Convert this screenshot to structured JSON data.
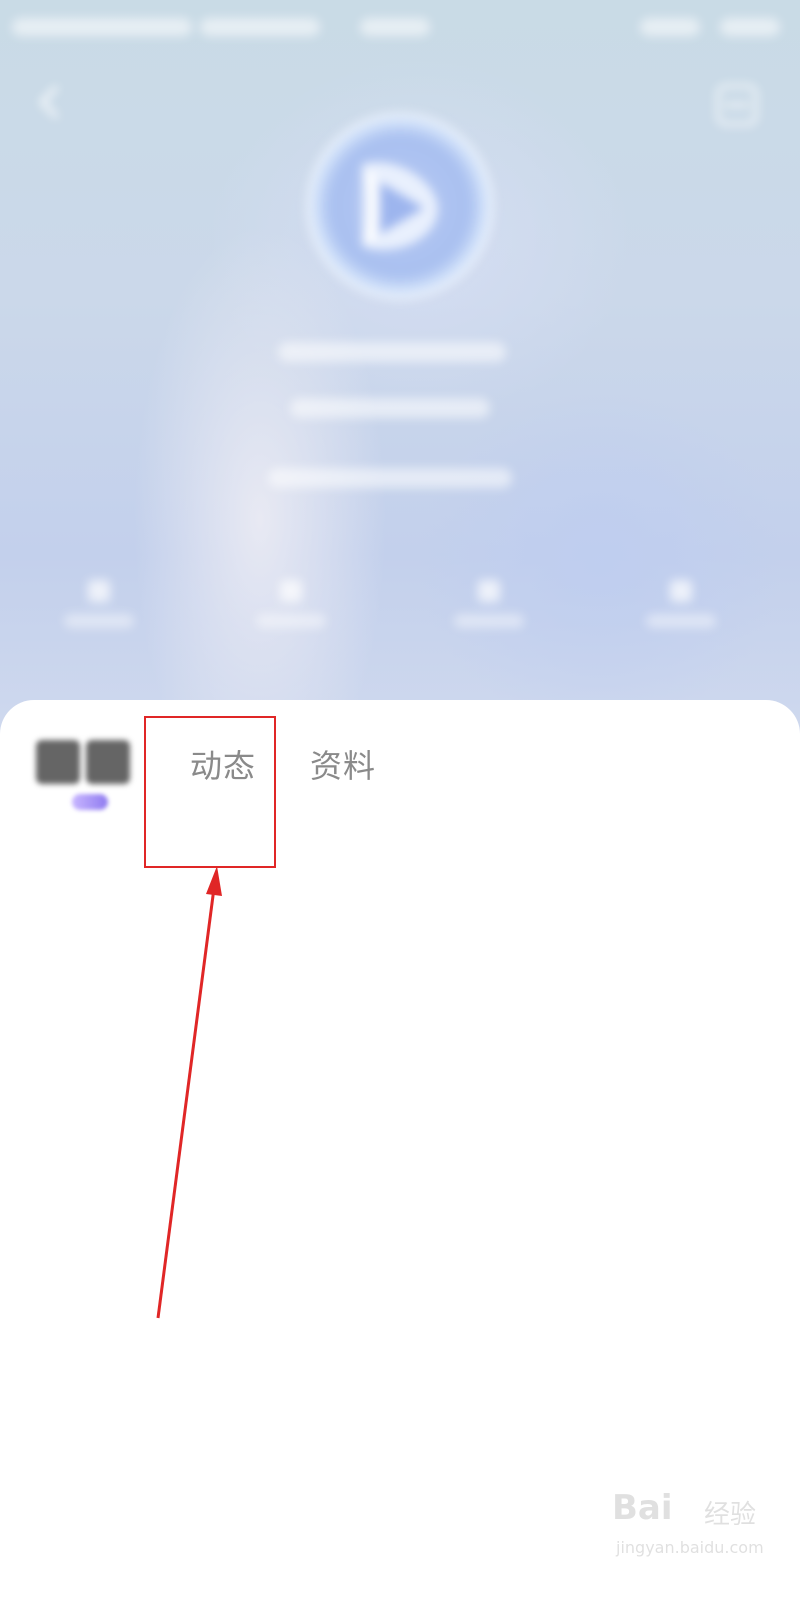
{
  "profile": {
    "tabs": [
      {
        "label": "动态"
      },
      {
        "label": "资料"
      }
    ]
  },
  "watermark": {
    "brand": "Bai",
    "brand_suffix": "经验",
    "url": "jingyan.baidu.com"
  },
  "colors": {
    "annotation": "#e02626",
    "tab_text": "#8a8a8a",
    "header_tint": "#c9d7ec"
  },
  "icons": [
    "back-arrow-icon",
    "more-icon",
    "avatar-play-logo-icon"
  ]
}
